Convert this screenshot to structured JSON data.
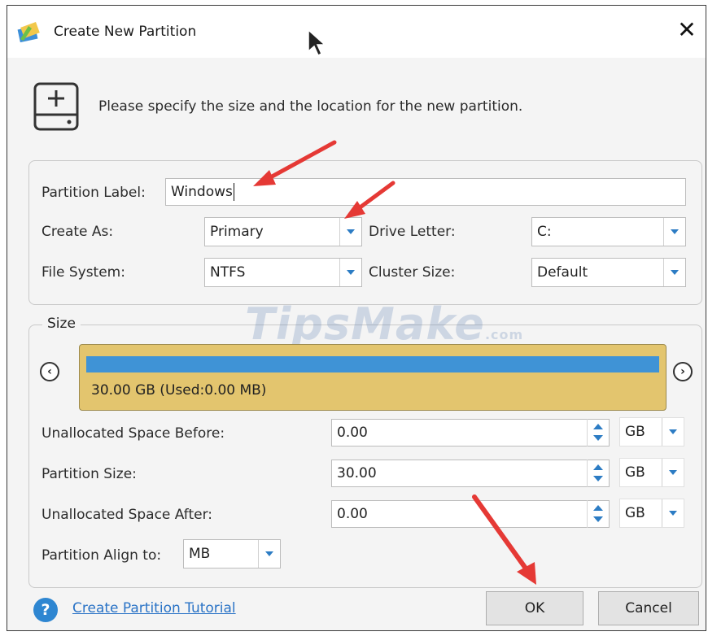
{
  "window": {
    "title": "Create New Partition",
    "close_glyph": "✕",
    "intro": "Please specify the size and the location for the new partition."
  },
  "partition": {
    "label_caption": "Partition Label:",
    "label_value": "Windows",
    "create_as_caption": "Create As:",
    "create_as_value": "Primary",
    "drive_letter_caption": "Drive Letter:",
    "drive_letter_value": "C:",
    "file_system_caption": "File System:",
    "file_system_value": "NTFS",
    "cluster_size_caption": "Cluster Size:",
    "cluster_size_value": "Default"
  },
  "size": {
    "legend": "Size",
    "bar_text": "30.00 GB (Used:0.00 MB)",
    "bar_fill_fraction": 1.0,
    "prev_glyph": "‹",
    "next_glyph": "›",
    "rows": [
      {
        "caption": "Unallocated Space Before:",
        "value": "0.00",
        "unit": "GB"
      },
      {
        "caption": "Partition Size:",
        "value": "30.00",
        "unit": "GB"
      },
      {
        "caption": "Unallocated Space After:",
        "value": "0.00",
        "unit": "GB"
      }
    ],
    "align_caption": "Partition Align to:",
    "align_value": "MB"
  },
  "footer": {
    "help_glyph": "?",
    "tutorial_link": "Create Partition Tutorial",
    "ok_label": "OK",
    "cancel_label": "Cancel"
  },
  "watermark": {
    "main": "TipsMake",
    "suffix": ".com"
  },
  "icons": {
    "app": "partition-wizard-icon",
    "add_disk": "add-disk-icon",
    "cursor": "mouse-pointer-icon",
    "annotation": "red-arrow-icon"
  },
  "colors": {
    "accent": "#2c7cc4",
    "bar_bg": "#e3c56e",
    "bar_fill": "#3f93d6",
    "link": "#2a73c6",
    "annotation_arrow": "#e53935"
  }
}
